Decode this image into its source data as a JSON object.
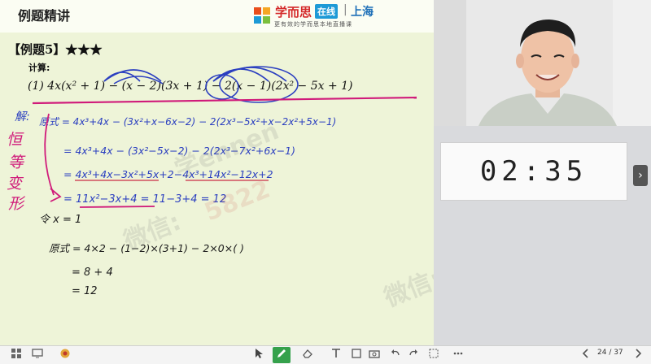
{
  "header": {
    "title": "例题精讲",
    "brand": "学而思",
    "brand_online": "在线",
    "brand_separator": "|",
    "brand_city": "上海",
    "slogan": "更有效的学而思本地直播课"
  },
  "example": {
    "title": "【例题5】★★★",
    "calc_label": "计算:",
    "problem": "(1) 4x(x² + 1) − (x − 2)(3x + 1) − 2(x − 1)(2x² − 5x + 1)"
  },
  "handwriting": {
    "solution_label": "解:",
    "line1": "原式 = 4x³+4x − (3x²+x−6x−2) − 2(2x³−5x²+x−2x²+5x−1)",
    "line2": "= 4x³+4x − (3x²−5x−2) − 2(2x³−7x²+6x−1)",
    "line3": "= 4x³+4x−3x²+5x+2−4x³+14x²−12x+2",
    "line4": "= 11x²−3x+4 = 11−3+4 = 12",
    "let": "令 x = 1",
    "check1": "原式 = 4×2 − (1−2)×(3+1) − 2×0×(      )",
    "check2": "= 8 + 4",
    "check3": "= 12",
    "side_note": [
      "恒",
      "等",
      "变",
      "形"
    ]
  },
  "watermark": {
    "line1": "学ennen",
    "line2": "微信:",
    "line3": "5822"
  },
  "timer": {
    "value": "02:35"
  },
  "side_arrow": "›",
  "toolbar": {
    "tools": [
      {
        "icon": "grid-icon",
        "label": "目录"
      },
      {
        "icon": "screen-icon",
        "label": "课件"
      },
      {
        "icon": "record-icon",
        "label": "回放"
      },
      {
        "icon": "cursor-icon",
        "label": "箭头"
      },
      {
        "icon": "pen-icon",
        "label": "画笔"
      },
      {
        "icon": "eraser-icon",
        "label": "橡皮"
      },
      {
        "icon": "text-icon",
        "label": "文字"
      },
      {
        "icon": "shape-icon",
        "label": "图形"
      },
      {
        "icon": "camera-icon",
        "label": "截图"
      },
      {
        "icon": "undo-icon",
        "label": "撤销"
      },
      {
        "icon": "redo-icon",
        "label": "重做"
      },
      {
        "icon": "select-icon",
        "label": "选择"
      },
      {
        "icon": "more-icon",
        "label": "更多"
      }
    ],
    "page": "24 / 37"
  },
  "colors": {
    "board": "#eef4d8",
    "ink_black": "#1b1b1b",
    "ink_blue": "#2b3fc0",
    "ink_red": "#cc2c45",
    "ink_magenta": "#d01a7a",
    "pen_active": "#35a14c"
  }
}
